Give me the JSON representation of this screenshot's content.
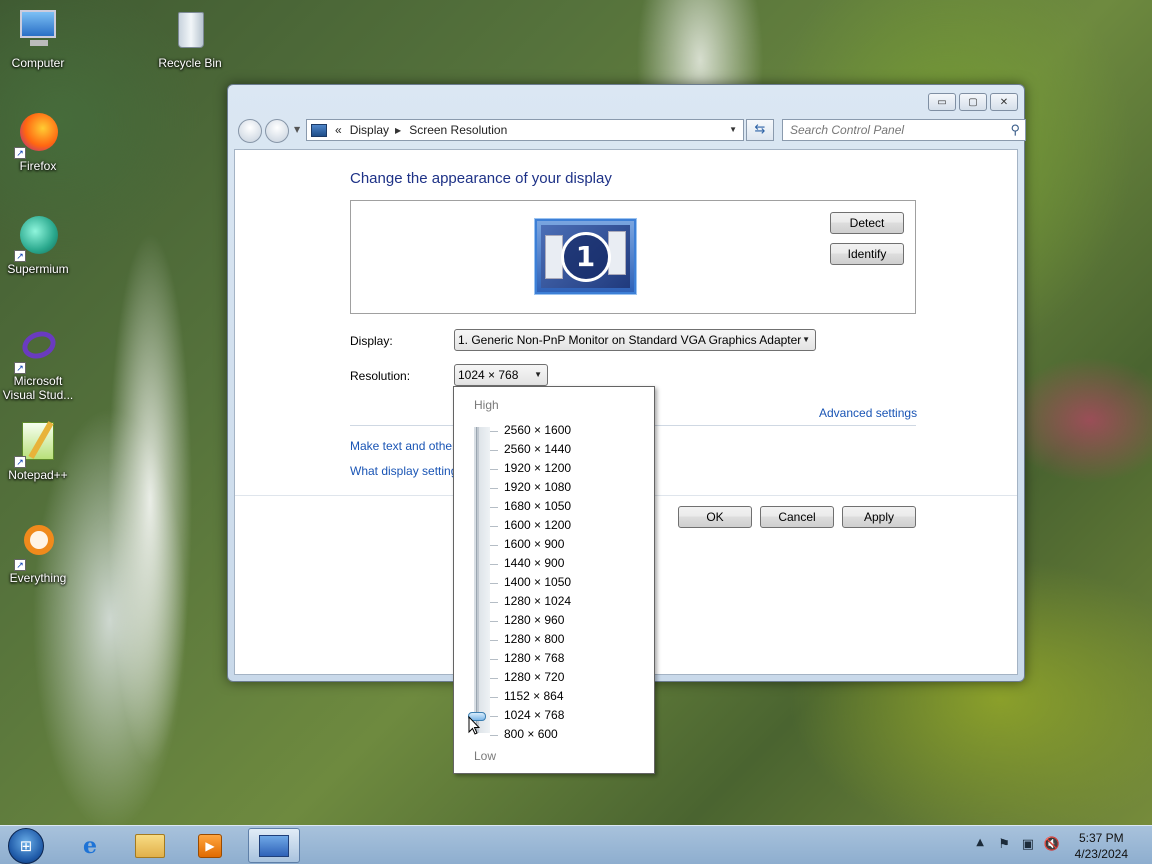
{
  "desktop": {
    "icons": [
      {
        "label": "Computer"
      },
      {
        "label": "Recycle Bin"
      },
      {
        "label": "Firefox"
      },
      {
        "label": "Supermium"
      },
      {
        "label": "Microsoft Visual Stud..."
      },
      {
        "label": "Notepad++"
      },
      {
        "label": "Everything"
      }
    ]
  },
  "window": {
    "controls": {
      "minimize": "▭",
      "maximize": "▢",
      "close": "✕"
    },
    "address": {
      "prefix": "«",
      "crumbs": [
        "Display",
        "Screen Resolution"
      ]
    },
    "search": {
      "placeholder": "Search Control Panel"
    },
    "heading": "Change the appearance of your display",
    "preview": {
      "monitor_number": "1"
    },
    "buttons": {
      "detect": "Detect",
      "identify": "Identify",
      "ok": "OK",
      "cancel": "Cancel",
      "apply": "Apply"
    },
    "display": {
      "label": "Display:",
      "value": "1. Generic Non-PnP Monitor on Standard VGA Graphics Adapter"
    },
    "resolution": {
      "label": "Resolution:",
      "value": "1024 × 768"
    },
    "links": {
      "advanced": "Advanced settings",
      "make_text": "Make text and other",
      "what_display": "What display setting"
    }
  },
  "resolution_popup": {
    "high_label": "High",
    "low_label": "Low",
    "options": [
      "2560 × 1600",
      "2560 × 1440",
      "1920 × 1200",
      "1920 × 1080",
      "1680 × 1050",
      "1600 × 1200",
      "1600 × 900",
      "1440 × 900",
      "1400 × 1050",
      "1280 × 1024",
      "1280 × 960",
      "1280 × 800",
      "1280 × 768",
      "1280 × 720",
      "1152 × 864",
      "1024 × 768",
      "800 × 600"
    ],
    "selected": "1024 × 768"
  },
  "taskbar": {
    "clock": {
      "time": "5:37 PM",
      "date": "4/23/2024"
    }
  },
  "colors": {
    "heading": "#1e3287",
    "link": "#1a55b5",
    "taskbar": "#8eaecf"
  }
}
